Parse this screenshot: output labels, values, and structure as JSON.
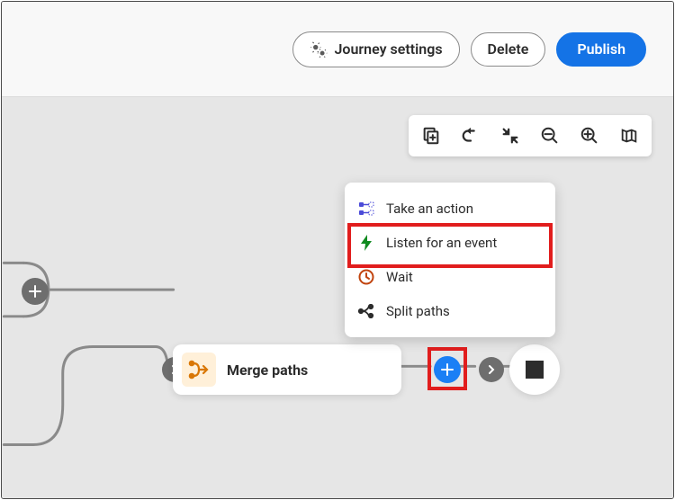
{
  "header": {
    "journey_settings_label": "Journey settings",
    "delete_label": "Delete",
    "publish_label": "Publish"
  },
  "toolbar": {
    "tools": [
      "duplicate",
      "undo",
      "collapse",
      "zoom-out",
      "zoom-in",
      "map"
    ]
  },
  "canvas": {
    "merge_card_label": "Merge paths"
  },
  "menu": {
    "items": [
      {
        "key": "take-action",
        "label": "Take an action",
        "icon": "action-icon",
        "color": "#4b4bd8"
      },
      {
        "key": "listen-event",
        "label": "Listen for an event",
        "icon": "bolt-icon",
        "color": "#0f8a1f"
      },
      {
        "key": "wait",
        "label": "Wait",
        "icon": "clock-icon",
        "color": "#c1440e"
      },
      {
        "key": "split-paths",
        "label": "Split paths",
        "icon": "split-icon",
        "color": "#2c2c2c"
      }
    ]
  }
}
